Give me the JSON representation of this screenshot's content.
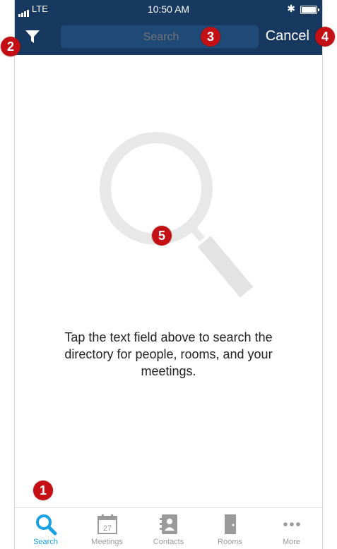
{
  "status_bar": {
    "carrier": "LTE",
    "time": "10:50 AM"
  },
  "header": {
    "filter_icon": "filter-icon",
    "search_placeholder": "Search",
    "search_value": "",
    "cancel_label": "Cancel"
  },
  "empty_state": {
    "icon": "magnifier-icon",
    "message_lines": [
      "Tap the text field above to search the",
      "directory for people, rooms, and your",
      "meetings."
    ]
  },
  "tabbar": {
    "active_tab": "Search",
    "items": [
      {
        "label": "Search",
        "icon": "search-icon"
      },
      {
        "label": "Meetings",
        "icon": "calendar-icon",
        "day": "27"
      },
      {
        "label": "Contacts",
        "icon": "contacts-icon"
      },
      {
        "label": "Rooms",
        "icon": "door-icon"
      },
      {
        "label": "More",
        "icon": "more-icon"
      }
    ]
  },
  "badges": [
    "1",
    "2",
    "3",
    "4",
    "5"
  ],
  "colors": {
    "header_bg": "#17395f",
    "search_bg": "#1f4a77",
    "active_tab": "#1aa1e4",
    "inactive_tab": "#9a9a9a",
    "badge": "#c40f14"
  }
}
